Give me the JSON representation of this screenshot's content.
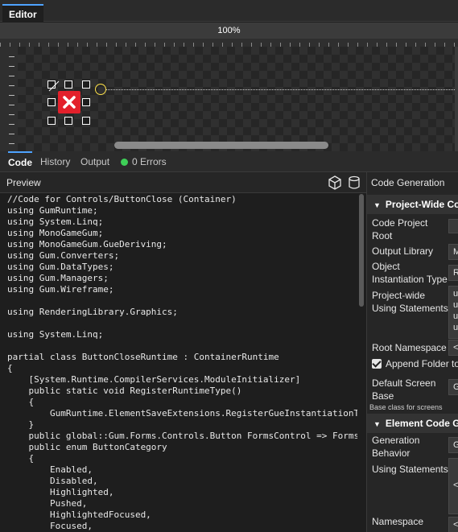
{
  "editor_tab": {
    "label": "Editor"
  },
  "canvas": {
    "zoom_label": "100%"
  },
  "lower_tabs": [
    {
      "label": "Code"
    },
    {
      "label": "History"
    },
    {
      "label": "Output"
    },
    {
      "label": "0 Errors"
    }
  ],
  "preview": {
    "title": "Preview",
    "code_lines": [
      "//Code for Controls/ButtonClose (Container)",
      "using GumRuntime;",
      "using System.Linq;",
      "using MonoGameGum;",
      "using MonoGameGum.GueDeriving;",
      "using Gum.Converters;",
      "using Gum.DataTypes;",
      "using Gum.Managers;",
      "using Gum.Wireframe;",
      "",
      "using RenderingLibrary.Graphics;",
      "",
      "using System.Linq;",
      "",
      "partial class ButtonCloseRuntime : ContainerRuntime",
      "{",
      "    [System.Runtime.CompilerServices.ModuleInitializer]",
      "    public static void RegisterRuntimeType()",
      "    {",
      "        GumRuntime.ElementSaveExtensions.RegisterGueInstantiationT",
      "    }",
      "    public global::Gum.Forms.Controls.Button FormsControl => Forms",
      "    public enum ButtonCategory",
      "    {",
      "        Enabled,",
      "        Disabled,",
      "        Highlighted,",
      "        Pushed,",
      "        HighlightedFocused,",
      "        Focused,"
    ]
  },
  "codegen": {
    "title": "Code Generation",
    "project_section": "Project-Wide Co",
    "code_project_root": "Code Project Root",
    "output_library": "Output Library",
    "output_library_value": "M",
    "object_instantiation": "Object Instantiation Type",
    "object_instantiation_value": "Re",
    "project_using": "Project-wide Using Statements",
    "project_using_values": [
      "u",
      "u",
      "u",
      "u"
    ],
    "root_namespace": "Root Namespace",
    "root_namespace_value": "<",
    "append_folder": "Append Folder to",
    "default_screen_base": "Default Screen Base",
    "default_screen_base_value": "G",
    "default_screen_hint": "Base class for screens",
    "element_section": "Element Code Ge",
    "generation_behavior": "Generation Behavior",
    "generation_behavior_value": "G",
    "using_statements": "Using Statements",
    "using_statements_value": "<",
    "namespace": "Namespace",
    "namespace_value": "<"
  },
  "colors": {
    "accent": "#4ea3ff",
    "error_ok": "#3ecf57",
    "close_red": "#e3202b",
    "handle_yellow": "#ffe24a"
  }
}
